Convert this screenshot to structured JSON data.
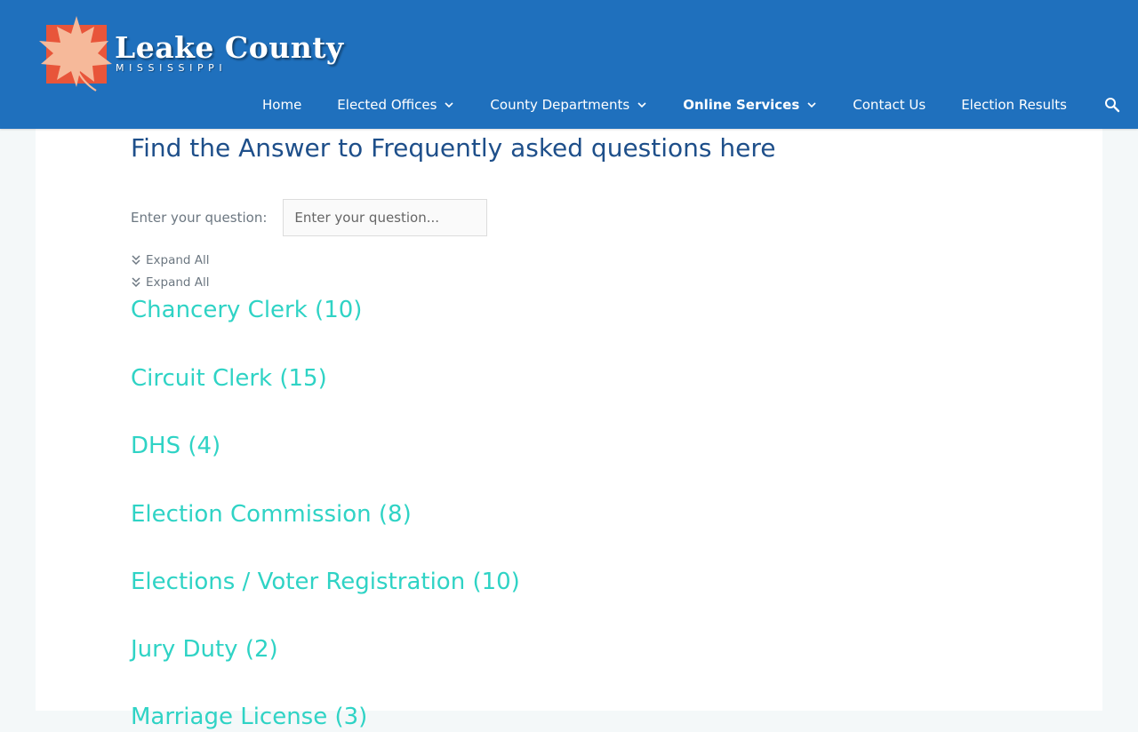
{
  "site": {
    "title": "Leake County",
    "subtitle": "MISSISSIPPI"
  },
  "nav": {
    "items": [
      {
        "label": "Home",
        "dropdown": false
      },
      {
        "label": "Elected Offices",
        "dropdown": true
      },
      {
        "label": "County Departments",
        "dropdown": true
      },
      {
        "label": "Online Services",
        "dropdown": true,
        "active": true
      },
      {
        "label": "Contact Us",
        "dropdown": false
      },
      {
        "label": "Election Results",
        "dropdown": false
      }
    ],
    "search_icon": "search-icon"
  },
  "faq": {
    "title": "Find the Answer to Frequently asked questions here",
    "search_label": "Enter your question:",
    "search_placeholder": "Enter your question...",
    "search_value": "",
    "expand_all": "Expand All",
    "categories": [
      "Chancery Clerk (10)",
      "Circuit Clerk (15)",
      "DHS (4)",
      "Election Commission (8)",
      "Elections / Voter Registration (10)",
      "Jury Duty (2)",
      "Marriage License (3)"
    ]
  },
  "colors": {
    "header_bg": "#1f70bd",
    "title": "#1e4f8a",
    "category": "#2fd3c5",
    "logo_square": "#e8553a",
    "logo_leaf": "#f6b99a"
  }
}
